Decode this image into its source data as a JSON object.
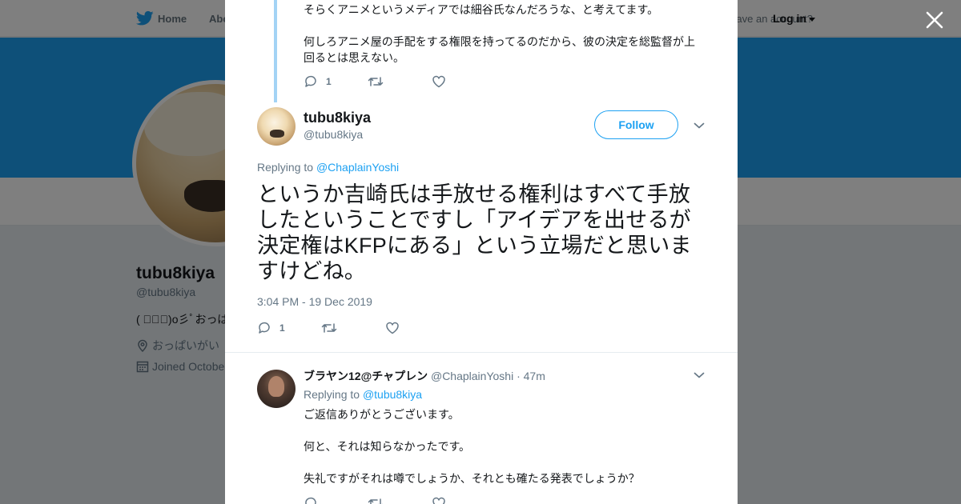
{
  "background": {
    "nav": {
      "home": "Home",
      "about": "Abo",
      "have_account": "Have an account?",
      "login": "Log in"
    },
    "profile": {
      "name": "tubu8kiya",
      "handle": "@tubu8kiya",
      "bio": "( ﾟ∀ﾟ)o彡ﾟおっぱ",
      "location": "おっぱいがい",
      "joined": "Joined Octobe"
    },
    "colors": {
      "banner": "#1da1f2",
      "accent": "#1da1f2"
    }
  },
  "modal": {
    "previous_tweet": {
      "paragraphs": [
        "そらくアニメというメディアでは細谷氏なんだろうな、と考えてます。",
        "何しろアニメ屋の手配をする権限を持ってるのだから、彼の決定を総監督が上回るとは思えない。"
      ],
      "reply_count": "1"
    },
    "main_tweet": {
      "name": "tubu8kiya",
      "handle": "@tubu8kiya",
      "follow_label": "Follow",
      "replying_prefix": "Replying to",
      "replying_to": "@ChaplainYoshi",
      "text": "というか吉崎氏は手放せる権利はすべて手放したということですし「アイデアを出せるが決定権はKFPにある」という立場だと思いますけどね。",
      "timestamp": "3:04 PM - 19 Dec 2019",
      "reply_count": "1"
    },
    "reply_tweet": {
      "name": "ブラヤン12@チャプレン",
      "handle": "@ChaplainYoshi",
      "time": "· 47m",
      "replying_prefix": "Replying to",
      "replying_to": "@tubu8kiya",
      "paragraphs": [
        "ご返信ありがとうございます。",
        "何と、それは知らなかったです。",
        "失礼ですがそれは噂でしょうか、それとも確たる発表でしょうか？"
      ]
    }
  }
}
